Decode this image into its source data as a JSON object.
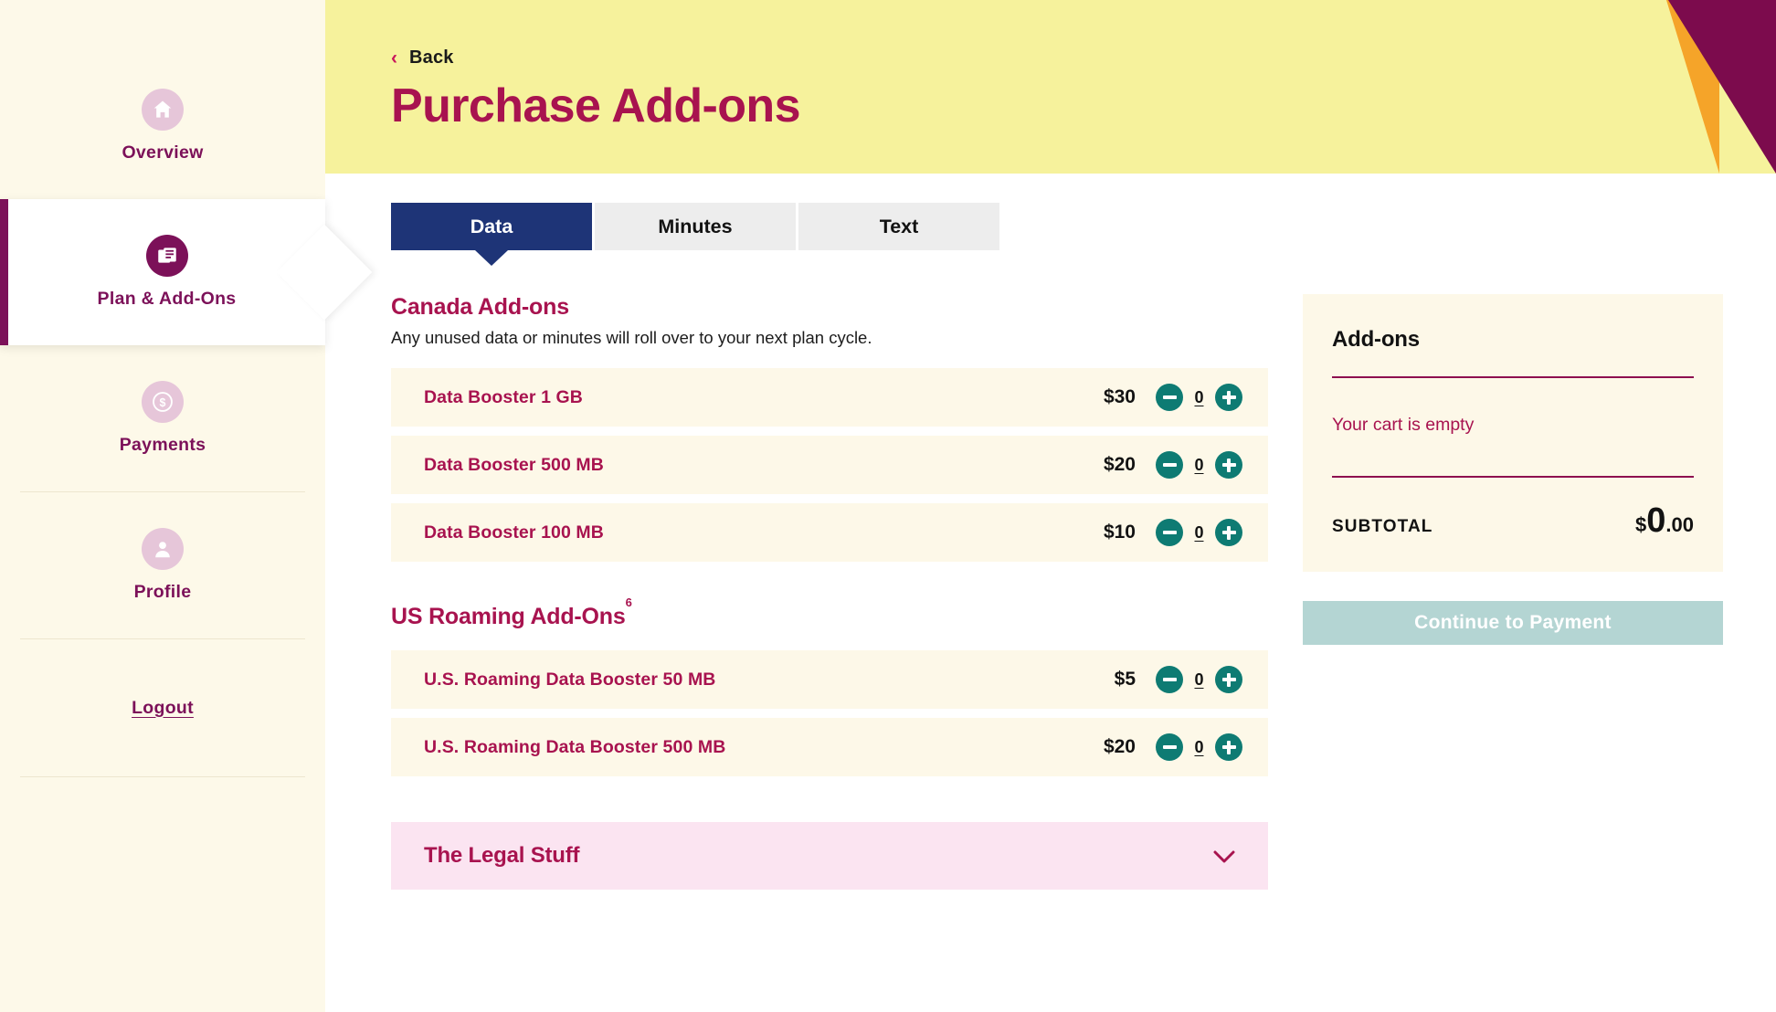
{
  "sidebar": {
    "items": [
      {
        "label": "Overview",
        "icon": "home-icon",
        "active": false
      },
      {
        "label": "Plan & Add-Ons",
        "icon": "document-icon",
        "active": true
      },
      {
        "label": "Payments",
        "icon": "dollar-coin-icon",
        "active": false
      },
      {
        "label": "Profile",
        "icon": "person-icon",
        "active": false
      }
    ],
    "logout_label": "Logout"
  },
  "hero": {
    "back_label": "Back",
    "back_chevron": "‹",
    "title": "Purchase Add-ons"
  },
  "tabs": [
    {
      "label": "Data",
      "active": true
    },
    {
      "label": "Minutes",
      "active": false
    },
    {
      "label": "Text",
      "active": false
    }
  ],
  "sections": [
    {
      "title": "Canada Add-ons",
      "superscript": "",
      "subtitle": "Any unused data or minutes will roll over to your next plan cycle.",
      "rows": [
        {
          "name": "Data Booster 1 GB",
          "price": "$30",
          "qty": "0"
        },
        {
          "name": "Data Booster 500 MB",
          "price": "$20",
          "qty": "0"
        },
        {
          "name": "Data Booster 100 MB",
          "price": "$10",
          "qty": "0"
        }
      ]
    },
    {
      "title": "US Roaming Add-Ons",
      "superscript": "6",
      "subtitle": "",
      "rows": [
        {
          "name": "U.S. Roaming Data Booster 50 MB",
          "price": "$5",
          "qty": "0"
        },
        {
          "name": "U.S. Roaming Data Booster 500 MB",
          "price": "$20",
          "qty": "0"
        }
      ]
    }
  ],
  "legal": {
    "title": "The Legal Stuff",
    "chevron": "⌄"
  },
  "cart": {
    "title": "Add-ons",
    "empty_message": "Your cart is empty",
    "subtotal_label": "SUBTOTAL",
    "subtotal_currency": "$",
    "subtotal_whole": "0",
    "subtotal_cents": ".00",
    "cta_label": "Continue to Payment"
  },
  "colors": {
    "brand_magenta": "#A8134F",
    "brand_purple": "#7C1159",
    "hero_yellow": "#F6F29C",
    "accent_orange": "#F5A429",
    "accent_dark_magenta": "#7C0B4D",
    "tab_active_navy": "#1E3477",
    "stepper_teal": "#0E7B73",
    "cta_disabled_teal": "#B4D5D3",
    "cream": "#FDF8E8",
    "legal_pink": "#FBE4F1"
  }
}
